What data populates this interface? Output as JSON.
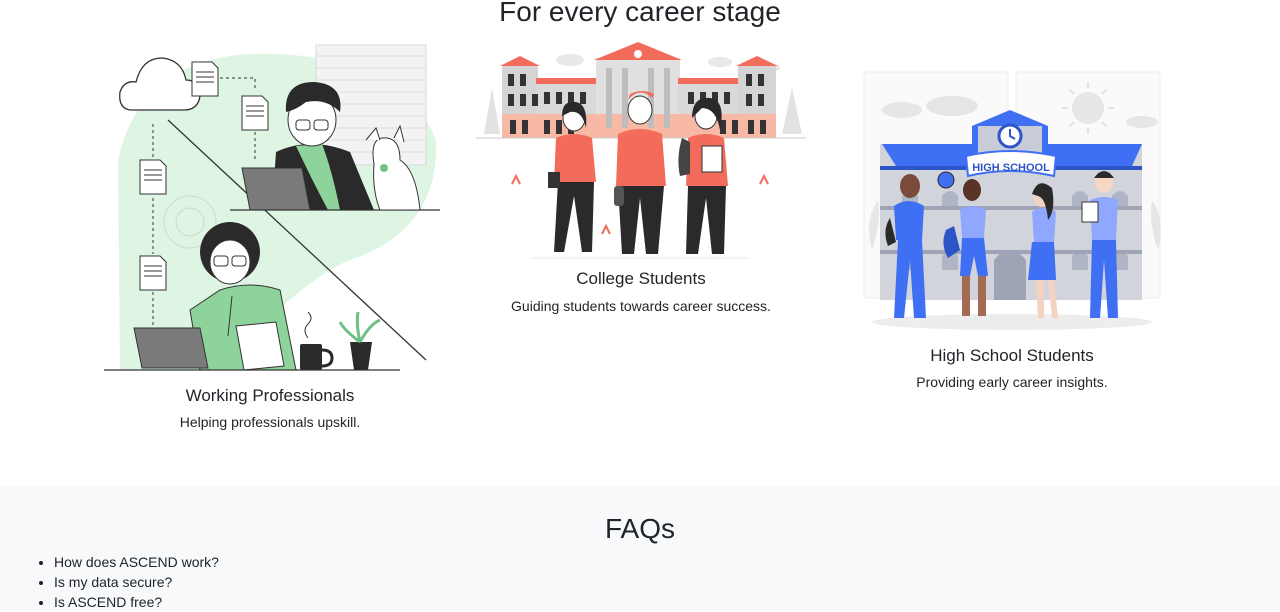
{
  "stage_section": {
    "title": "For every career stage",
    "cards": [
      {
        "title": "Working Professionals",
        "text": "Helping professionals upskill."
      },
      {
        "title": "College Students",
        "text": "Guiding students towards career success."
      },
      {
        "title": "High School Students",
        "text": "Providing early career insights."
      }
    ]
  },
  "illustration_text": {
    "school_sign": "HIGH SCHOOL"
  },
  "faq": {
    "title": "FAQs",
    "items": [
      "How does ASCEND work?",
      "Is my data secure?",
      "Is ASCEND free?"
    ]
  },
  "colors": {
    "green": "#bfe9c9",
    "coral": "#f26b5b",
    "blue": "#3f6ff2",
    "dark": "#2a2a2a"
  }
}
